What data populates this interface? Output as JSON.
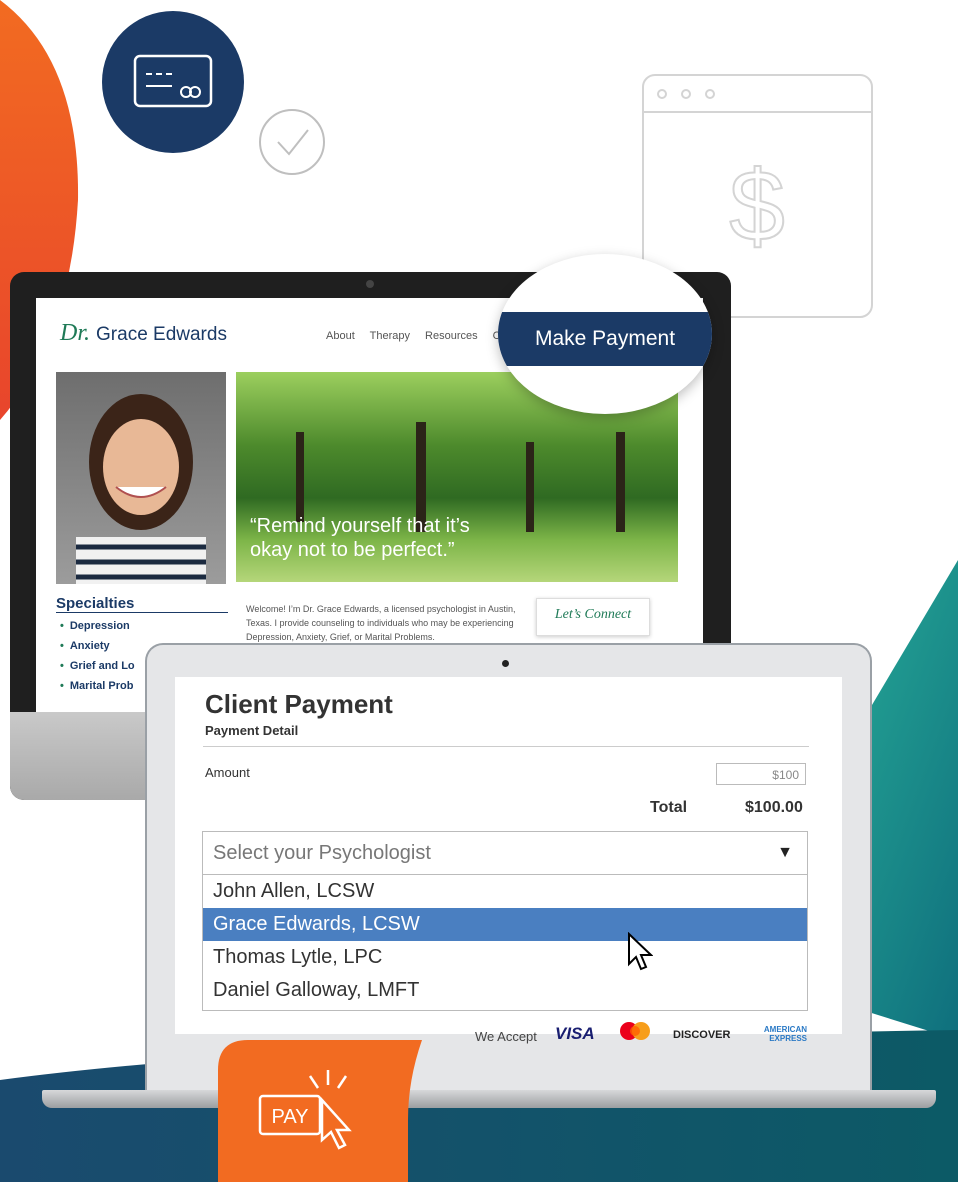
{
  "monitor_site": {
    "logo_prefix": "Dr.",
    "logo_name": "Grace Edwards",
    "nav": [
      "About",
      "Therapy",
      "Resources",
      "Co"
    ],
    "hero_quote_line1": "“Remind yourself that it’s",
    "hero_quote_line2": "okay not to be perfect.”",
    "specialties_title": "Specialties",
    "specialties": [
      "Depression",
      "Anxiety",
      "Grief and Lo",
      "Marital Prob"
    ],
    "welcome_text": "Welcome! I’m Dr. Grace Edwards, a licensed psychologist in Austin, Texas. I provide counseling to individuals who may be experiencing Depression, Anxiety, Grief, or Marital Problems.",
    "connect_label": "Let’s Connect",
    "make_payment": "Make Payment"
  },
  "payment": {
    "title": "Client Payment",
    "subtitle": "Payment Detail",
    "amount_label": "Amount",
    "amount_value": "$100",
    "total_label": "Total",
    "total_value": "$100.00",
    "select_placeholder": "Select your Psychologist",
    "options": [
      "John Allen, LCSW",
      "Grace Edwards, LCSW",
      "Thomas Lytle, LPC",
      "Daniel Galloway, LMFT"
    ],
    "selected_index": 1,
    "we_accept": "We Accept",
    "cards": [
      "VISA",
      "mastercard",
      "DISCOVER",
      "AMERICAN EXPRESS"
    ]
  },
  "badge": {
    "label": "PAY"
  },
  "icons": [
    "credit-card-icon",
    "checkmark-icon",
    "browser-dollar-icon",
    "cursor-icon",
    "pay-click-icon"
  ],
  "colors": {
    "navy": "#1b3a66",
    "green": "#1f7a57",
    "orange": "#f26b21",
    "teal": "#1aa08a",
    "selected_blue": "#4a7fc1"
  }
}
